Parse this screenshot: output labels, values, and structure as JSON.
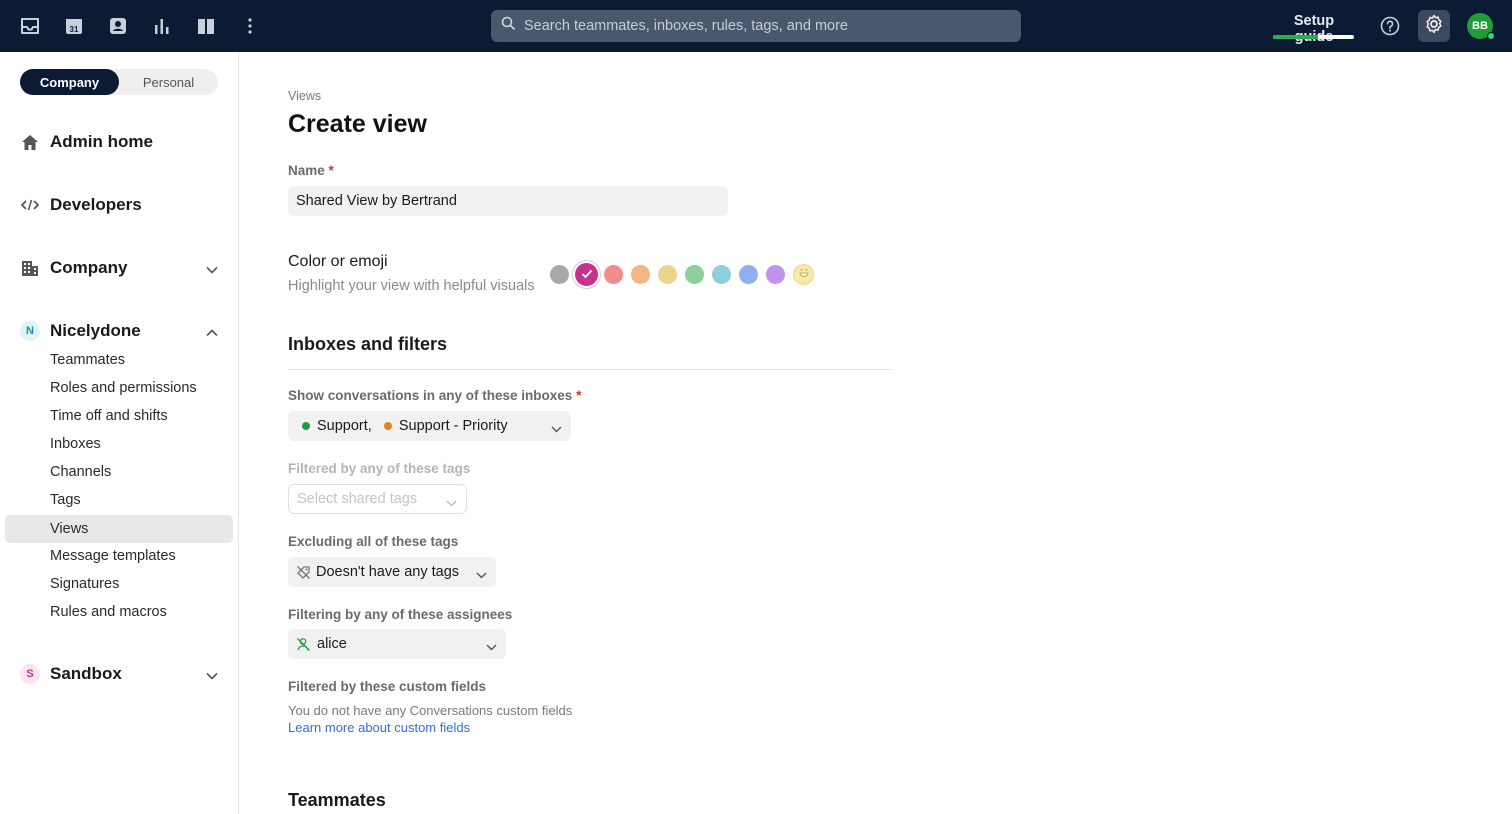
{
  "topbar": {
    "icons": [
      "inbox-icon",
      "calendar-icon",
      "contacts-icon",
      "analytics-icon",
      "knowledge-base-icon",
      "more-icon"
    ],
    "search_placeholder": "Search teammates, inboxes, rules, tags, and more",
    "setup_guide_label": "Setup guide",
    "setup_progress": 0.55,
    "avatar_initials": "BB"
  },
  "sidebar": {
    "segment": {
      "company": "Company",
      "personal": "Personal",
      "active": "Company"
    },
    "admin_home": "Admin home",
    "developers": "Developers",
    "company": "Company",
    "workspace": {
      "badge": "N",
      "label": "Nicelydone"
    },
    "items": [
      {
        "label": "Teammates"
      },
      {
        "label": "Roles and permissions"
      },
      {
        "label": "Time off and shifts"
      },
      {
        "label": "Inboxes"
      },
      {
        "label": "Channels"
      },
      {
        "label": "Tags"
      },
      {
        "label": "Views",
        "active": true
      },
      {
        "label": "Message templates"
      },
      {
        "label": "Signatures"
      },
      {
        "label": "Rules and macros"
      }
    ],
    "sandbox": {
      "badge": "S",
      "label": "Sandbox"
    }
  },
  "main": {
    "breadcrumb": "Views",
    "title": "Create view",
    "name_label": "Name",
    "required_mark": "*",
    "name_value": "Shared View by Bertrand",
    "color_title": "Color or emoji",
    "color_subtitle": "Highlight your view with helpful visuals",
    "colors": [
      "#a8a8a8",
      "#c8328f",
      "#f08c8c",
      "#f5b585",
      "#ecd48c",
      "#8dcf95",
      "#8fcfdc",
      "#8fb0f0",
      "#c094ec"
    ],
    "selected_color": "#c8328f",
    "section_inboxes": "Inboxes and filters",
    "inboxes_label": "Show conversations in any of these inboxes",
    "inboxes": [
      {
        "name": "Support,",
        "color": "#1f9d3a"
      },
      {
        "name": "Support - Priority",
        "color": "#e7821c"
      }
    ],
    "tags_label": "Filtered by any of these tags",
    "tags_placeholder": "Select shared tags",
    "exclude_label": "Excluding all of these tags",
    "exclude_value": "Doesn't have any tags",
    "assignee_label": "Filtering by any of these assignees",
    "assignee_value": "alice",
    "custom_fields_label": "Filtered by these custom fields",
    "custom_fields_helper": "You do not have any Conversations custom fields",
    "custom_fields_link": "Learn more about custom fields",
    "section_teammates": "Teammates"
  }
}
